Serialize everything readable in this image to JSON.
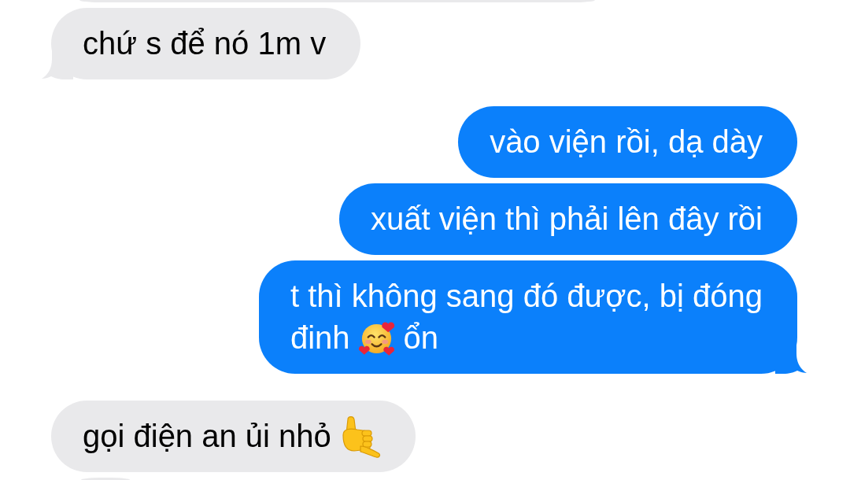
{
  "messages": [
    {
      "kind": "partial",
      "outgoing": false,
      "top_hidden": true
    },
    {
      "kind": "message",
      "outgoing": false,
      "tail": true,
      "lines": [
        [
          {
            "kind": "text",
            "text": "chứ s để nó 1m v"
          }
        ]
      ]
    },
    {
      "kind": "message",
      "outgoing": true,
      "tail": false,
      "lines": [
        [
          {
            "kind": "text",
            "text": "vào viện rồi, dạ dày"
          }
        ]
      ]
    },
    {
      "kind": "message",
      "outgoing": true,
      "tail": false,
      "lines": [
        [
          {
            "kind": "text",
            "text": "xuất viện thì phải lên đây rồi"
          }
        ]
      ]
    },
    {
      "kind": "message",
      "outgoing": true,
      "tail": true,
      "lines": [
        [
          {
            "kind": "text",
            "text": "t thì không sang đó được, bị đóng"
          }
        ],
        [
          {
            "kind": "text",
            "text": "đinh"
          },
          {
            "kind": "hearts"
          },
          {
            "kind": "text",
            "text": "ổn"
          }
        ]
      ]
    },
    {
      "kind": "message",
      "outgoing": false,
      "tail": false,
      "lines": [
        [
          {
            "kind": "text",
            "text": "gọi điện an ủi nhỏ"
          },
          {
            "kind": "shaka"
          }
        ]
      ]
    },
    {
      "kind": "partial",
      "outgoing": false,
      "top_hidden": false
    }
  ]
}
